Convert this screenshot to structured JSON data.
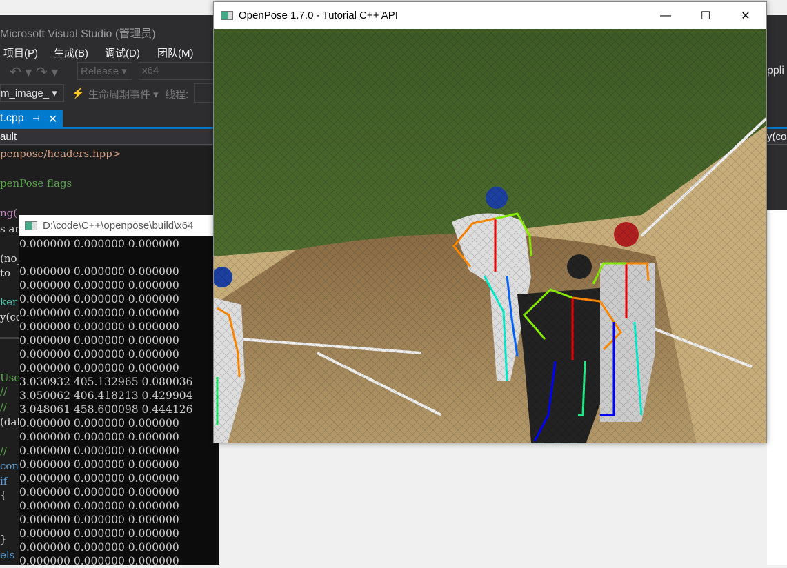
{
  "vs": {
    "title": "Microsoft Visual Studio (管理员)",
    "menu": [
      "项目(P)",
      "生成(B)",
      "调试(D)",
      "团队(M)"
    ],
    "config": "Release",
    "platform": "x64",
    "project": "m_image_",
    "lifecycle": "生命周期事件",
    "thread_label": "线程:",
    "tab": "t.cpp",
    "nav": "ault",
    "right_toolbar": "ppli",
    "right_nav": "y(co",
    "code_lines": [
      {
        "text": "penpose/headers.hpp>",
        "color": "#d69d85"
      },
      {
        "text": "penPose flags",
        "color": "#57a64a"
      },
      {
        "text": "ng(",
        "color": "#c586c0"
      },
      {
        "text": "s ar",
        "color": "#dcdcdc"
      },
      {
        "text": "(no_",
        "color": "#dcdcdc"
      },
      {
        "text": " to",
        "color": "#dcdcdc"
      },
      {
        "text": "ker",
        "color": "#4ec9b0"
      },
      {
        "text": "y(co",
        "color": "#dcdcdc"
      },
      {
        "text": "User",
        "color": "#57a64a"
      },
      {
        "text": " //",
        "color": "#57a64a"
      },
      {
        "text": " //",
        "color": "#57a64a"
      },
      {
        "text": "(dat",
        "color": "#dcdcdc"
      },
      {
        "text": " //",
        "color": "#57a64a"
      },
      {
        "text": " con",
        "color": "#569cd6"
      },
      {
        "text": " if",
        "color": "#569cd6"
      },
      {
        "text": " {",
        "color": "#dcdcdc"
      },
      {
        "text": " }",
        "color": "#dcdcdc"
      },
      {
        "text": " els",
        "color": "#569cd6"
      }
    ]
  },
  "console": {
    "title": "D:\\code\\C++\\openpose\\build\\x64",
    "rows": [
      "0.000000 0.000000 0.000000",
      "",
      "0.000000 0.000000 0.000000",
      "0.000000 0.000000 0.000000",
      "0.000000 0.000000 0.000000",
      "0.000000 0.000000 0.000000",
      "0.000000 0.000000 0.000000",
      "0.000000 0.000000 0.000000",
      "0.000000 0.000000 0.000000",
      "0.000000 0.000000 0.000000",
      "3.030932 405.132965 0.080036",
      "3.050062 406.418213 0.429904",
      "3.048061 458.600098 0.444126",
      "0.000000 0.000000 0.000000",
      "0.000000 0.000000 0.000000",
      "0.000000 0.000000 0.000000",
      "0.000000 0.000000 0.000000",
      "0.000000 0.000000 0.000000",
      "0.000000 0.000000 0.000000",
      "0.000000 0.000000 0.000000",
      "0.000000 0.000000 0.000000",
      "0.000000 0.000000 0.000000",
      "0.000000 0.000000 0.000000",
      "0.000000 0.000000 0.000000"
    ]
  },
  "openpose": {
    "title": "OpenPose 1.7.0 - Tutorial C++ API",
    "minimize": "—",
    "maximize": "☐",
    "close": "✕"
  }
}
